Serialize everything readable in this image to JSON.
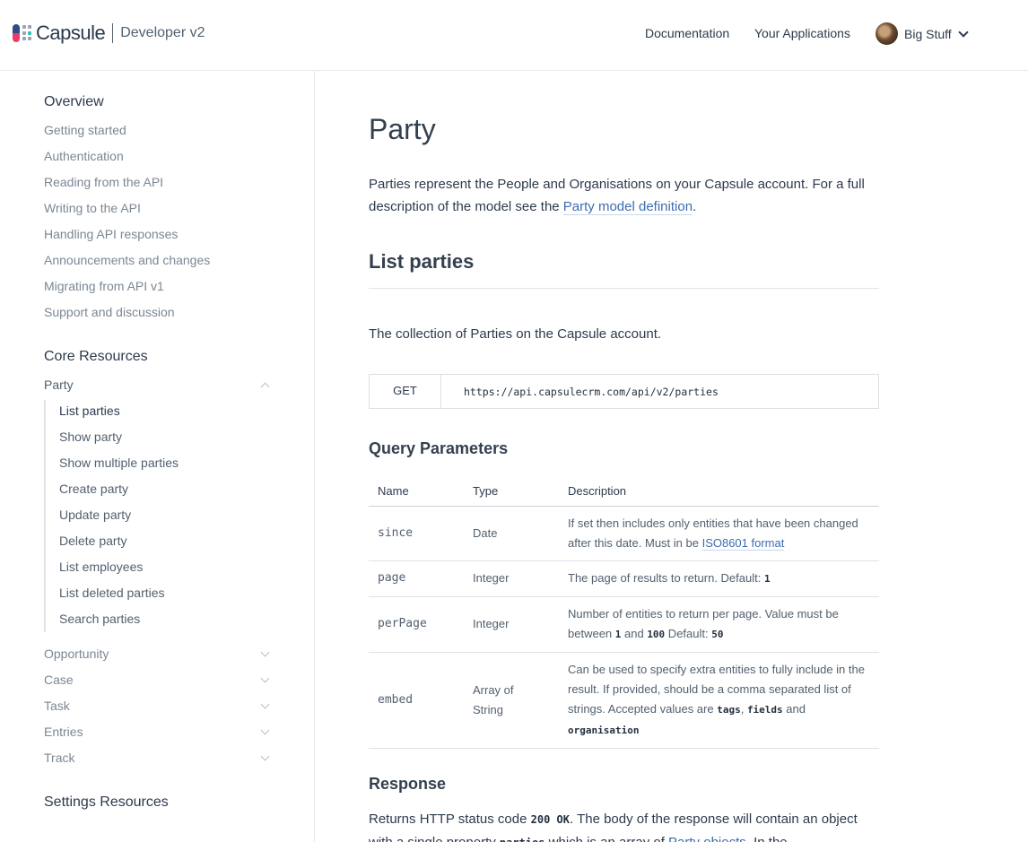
{
  "header": {
    "logo_text": "Capsule",
    "logo_sub": "Developer v2",
    "nav": {
      "documentation": "Documentation",
      "your_applications": "Your Applications"
    },
    "user_name": "Big Stuff"
  },
  "sidebar": {
    "overview_heading": "Overview",
    "overview_items": [
      "Getting started",
      "Authentication",
      "Reading from the API",
      "Writing to the API",
      "Handling API responses",
      "Announcements and changes",
      "Migrating from API v1",
      "Support and discussion"
    ],
    "core_heading": "Core Resources",
    "party_label": "Party",
    "party_items": [
      "List parties",
      "Show party",
      "Show multiple parties",
      "Create party",
      "Update party",
      "Delete party",
      "List employees",
      "List deleted parties",
      "Search parties"
    ],
    "other_resources": [
      "Opportunity",
      "Case",
      "Task",
      "Entries",
      "Track"
    ],
    "settings_heading": "Settings Resources"
  },
  "main": {
    "title": "Party",
    "intro_text": "Parties represent the People and Organisations on your Capsule account. For a full description of the model see the ",
    "intro_link": "Party model definition",
    "intro_end": ".",
    "section_title": "List parties",
    "collection_text": "The collection of Parties on the Capsule account.",
    "endpoint": {
      "method": "GET",
      "url": "https://api.capsulecrm.com/api/v2/parties"
    },
    "query_heading": "Query Parameters",
    "table": {
      "headers": [
        "Name",
        "Type",
        "Description"
      ],
      "rows": [
        {
          "name": "since",
          "type": "Date",
          "desc": "If set then includes only entities that have been changed after this date. Must in be ",
          "link": "ISO8601 format"
        },
        {
          "name": "page",
          "type": "Integer",
          "desc": "The page of results to return. Default: ",
          "code1": "1"
        },
        {
          "name": "perPage",
          "type": "Integer",
          "desc_a": "Number of entities to return per page. Value must be between ",
          "code1": "1",
          "desc_b": " and ",
          "code2": "100",
          "desc_c": " Default: ",
          "code3": "50"
        },
        {
          "name": "embed",
          "type": "Array of String",
          "desc_a": "Can be used to specify extra entities to fully include in the result. If provided, should be a comma separated list of strings. Accepted values are ",
          "code1": "tags",
          "desc_b": ", ",
          "code2": "fields",
          "desc_c": " and ",
          "code3": "organisation"
        }
      ]
    },
    "response_heading": "Response",
    "response_a": "Returns HTTP status code ",
    "response_code": "200 OK",
    "response_b": ". The body of the response will contain an object with a single property ",
    "response_code2": "parties",
    "response_c": " which is an array of ",
    "response_link": "Party objects",
    "response_d": ". In the"
  },
  "colors": {
    "link": "#3d6cb3",
    "text": "#2d3a4d",
    "muted": "#7b8794",
    "border": "#dfe3e8"
  }
}
